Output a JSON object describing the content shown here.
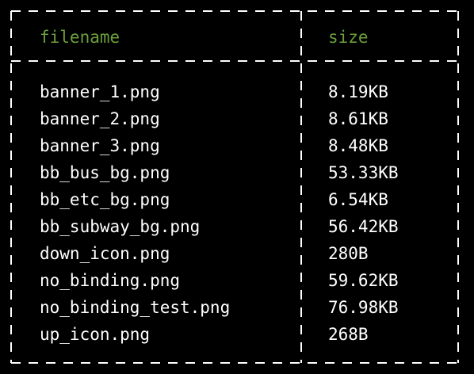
{
  "colors": {
    "background": "#000000",
    "header_text": "#6a9f3b",
    "cell_text": "#ffffff",
    "border": "#ffffff"
  },
  "table": {
    "headers": [
      "filename",
      "size"
    ],
    "rows": [
      [
        "banner_1.png",
        "8.19KB"
      ],
      [
        "banner_2.png",
        "8.61KB"
      ],
      [
        "banner_3.png",
        "8.48KB"
      ],
      [
        "bb_bus_bg.png",
        "53.33KB"
      ],
      [
        "bb_etc_bg.png",
        "6.54KB"
      ],
      [
        "bb_subway_bg.png",
        "56.42KB"
      ],
      [
        "down_icon.png",
        "280B"
      ],
      [
        "no_binding.png",
        "59.62KB"
      ],
      [
        "no_binding_test.png",
        "76.98KB"
      ],
      [
        "up_icon.png",
        "268B"
      ]
    ]
  }
}
